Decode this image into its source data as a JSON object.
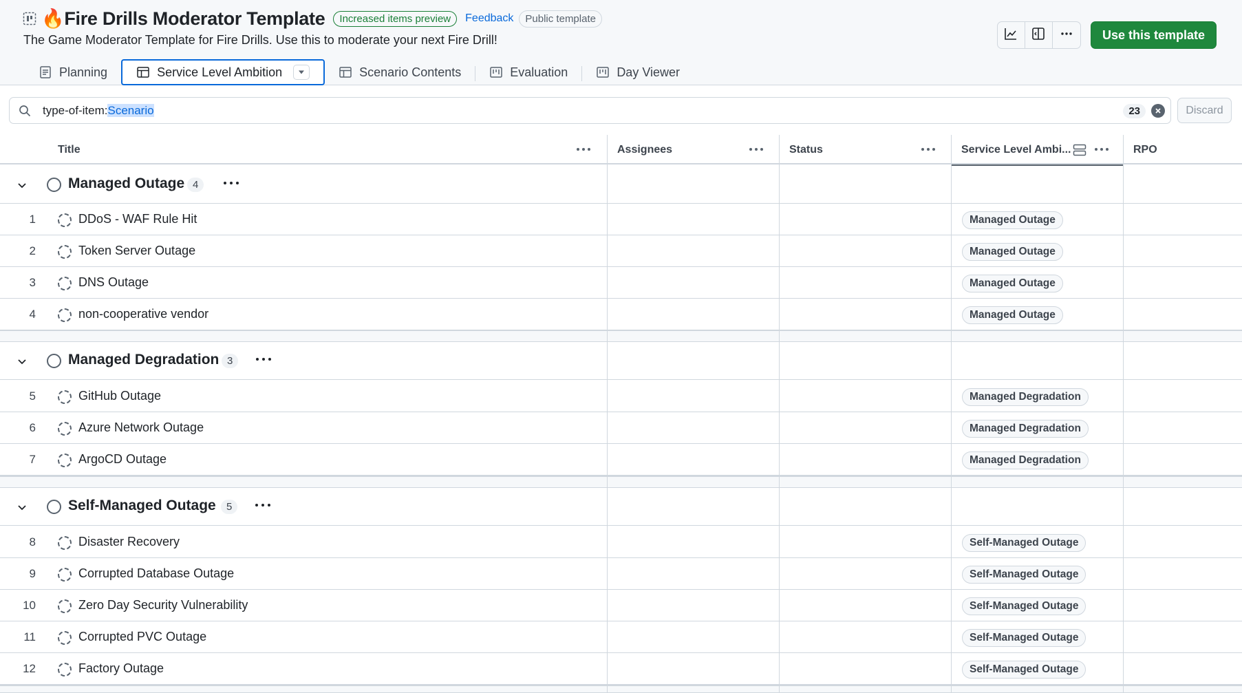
{
  "project": {
    "title": "🔥Fire Drills Moderator Template",
    "preview_badge": "Increased items preview",
    "feedback_link": "Feedback",
    "public_badge": "Public template",
    "description": "The Game Moderator Template for Fire Drills. Use this to moderate your next Fire Drill!",
    "use_template_label": "Use this template",
    "icons": [
      "project-template-icon",
      "insights-icon",
      "side-panel-icon",
      "kebab-horizontal-icon"
    ]
  },
  "tabs": [
    {
      "label": "Planning",
      "icon": "document-icon"
    },
    {
      "label": "Service Level Ambition",
      "icon": "table-icon",
      "active": true
    },
    {
      "label": "Scenario Contents",
      "icon": "table-icon"
    },
    {
      "label": "Evaluation",
      "icon": "board-icon"
    },
    {
      "label": "Day Viewer",
      "icon": "board-icon"
    }
  ],
  "filter": {
    "key": "type-of-item:",
    "value": "Scenario",
    "count": "23",
    "discard_label": "Discard"
  },
  "columns": {
    "title": "Title",
    "assignees": "Assignees",
    "status": "Status",
    "service_level": "Service Level Ambi...",
    "rpo": "RPO"
  },
  "groups": [
    {
      "name": "Managed Outage",
      "count": "4",
      "items": [
        {
          "num": "1",
          "title": "DDoS - WAF Rule Hit",
          "tag": "Managed Outage"
        },
        {
          "num": "2",
          "title": "Token Server Outage",
          "tag": "Managed Outage"
        },
        {
          "num": "3",
          "title": "DNS Outage",
          "tag": "Managed Outage"
        },
        {
          "num": "4",
          "title": "non-cooperative vendor",
          "tag": "Managed Outage"
        }
      ]
    },
    {
      "name": "Managed Degradation",
      "count": "3",
      "items": [
        {
          "num": "5",
          "title": "GitHub Outage",
          "tag": "Managed Degradation"
        },
        {
          "num": "6",
          "title": "Azure Network Outage",
          "tag": "Managed Degradation"
        },
        {
          "num": "7",
          "title": "ArgoCD Outage",
          "tag": "Managed Degradation"
        }
      ]
    },
    {
      "name": "Self-Managed Outage",
      "count": "5",
      "items": [
        {
          "num": "8",
          "title": "Disaster Recovery",
          "tag": "Self-Managed Outage"
        },
        {
          "num": "9",
          "title": "Corrupted Database Outage",
          "tag": "Self-Managed Outage"
        },
        {
          "num": "10",
          "title": "Zero Day Security Vulnerability",
          "tag": "Self-Managed Outage"
        },
        {
          "num": "11",
          "title": "Corrupted PVC Outage",
          "tag": "Self-Managed Outage"
        },
        {
          "num": "12",
          "title": "Factory Outage",
          "tag": "Self-Managed Outage"
        }
      ]
    }
  ],
  "colors": {
    "accent": "#0969da",
    "primary_button": "#1f883d",
    "border": "#d0d7de",
    "header_bg": "#f6f8fa"
  }
}
